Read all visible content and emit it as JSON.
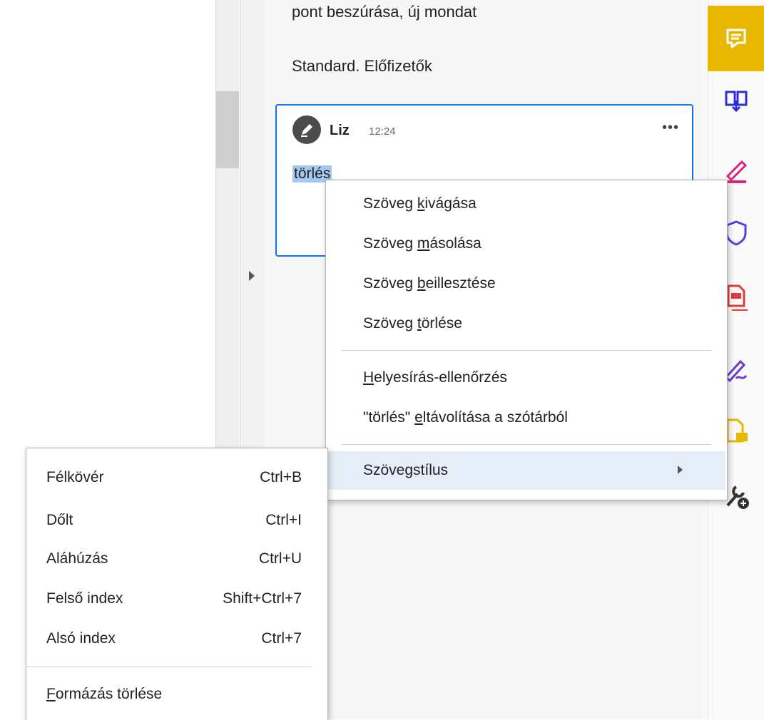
{
  "panel": {
    "text_line_1": "pont beszúrása, új mondat",
    "text_line_2": "Standard. Előfizetők"
  },
  "comment": {
    "author": "Liz",
    "time": "12:24",
    "more_label": "•••",
    "text": "törlés"
  },
  "context_menu": {
    "items": [
      {
        "pre": "Szöveg ",
        "accel": "k",
        "post": "ivágása"
      },
      {
        "pre": "Szöveg ",
        "accel": "m",
        "post": "ásolása"
      },
      {
        "pre": "Szöveg ",
        "accel": "b",
        "post": "eillesztése"
      },
      {
        "pre": "Szöveg ",
        "accel": "t",
        "post": "örlése"
      },
      {
        "pre": "",
        "accel": "H",
        "post": "elyesírás-ellenőrzés"
      },
      {
        "pre": "\"törlés\" ",
        "accel": "e",
        "post": "ltávolítása a szótárból"
      },
      {
        "pre": "Szövegstílus",
        "accel": "",
        "post": ""
      }
    ]
  },
  "style_submenu": {
    "items": [
      {
        "label": "Félkövér",
        "shortcut": "Ctrl+B"
      },
      {
        "label": "Dőlt",
        "shortcut": "Ctrl+I"
      },
      {
        "label": "Aláhúzás",
        "shortcut": "Ctrl+U"
      },
      {
        "label": "Felső index",
        "shortcut": "Shift+Ctrl+7"
      },
      {
        "label": "Alsó index",
        "shortcut": "Ctrl+7"
      }
    ],
    "clear": {
      "accel": "F",
      "post": "ormázás törlése"
    }
  },
  "toolbar": {
    "icons": [
      "comment-icon",
      "organize-pages-icon",
      "fill-sign-icon",
      "protect-icon",
      "export-pdf-icon",
      "sign-icon",
      "comment-file-icon",
      "more-tools-icon"
    ]
  },
  "colors": {
    "accent_blue": "#1473e6",
    "active_tool": "#e8b800",
    "selection": "#a4c8ee",
    "menu_highlight": "#e5eef8"
  }
}
